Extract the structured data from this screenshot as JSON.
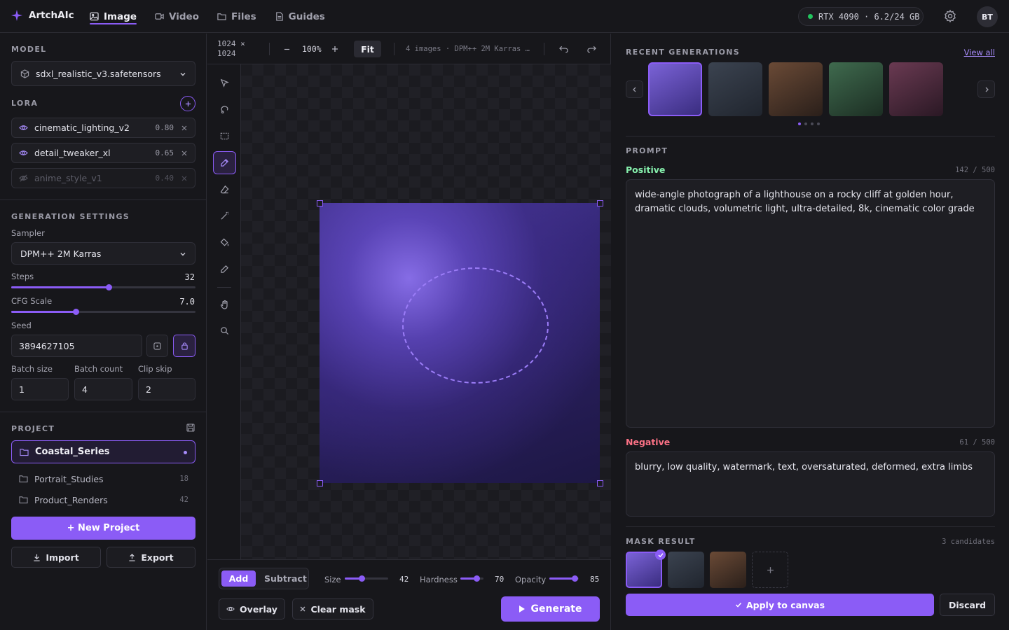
{
  "app": {
    "name": "ArtchAIc"
  },
  "nav": {
    "tabs": [
      {
        "label": "Image",
        "icon": "image-icon",
        "active": true
      },
      {
        "label": "Video",
        "icon": "video-icon"
      },
      {
        "label": "Files",
        "icon": "folder-icon"
      },
      {
        "label": "Guides",
        "icon": "document-icon"
      }
    ]
  },
  "status": {
    "gpu": "RTX 4090 · 6.2/24 GB",
    "gpu_color": "#22c55e"
  },
  "user": {
    "initials": "BT"
  },
  "model": {
    "title": "MODEL",
    "selected": "sdxl_realistic_v3.safetensors"
  },
  "lora": {
    "title": "LORA",
    "items": [
      {
        "name": "cinematic_lighting_v2",
        "weight": "0.80",
        "enabled": true
      },
      {
        "name": "detail_tweaker_xl",
        "weight": "0.65",
        "enabled": true
      },
      {
        "name": "anime_style_v1",
        "weight": "0.40",
        "enabled": false
      }
    ]
  },
  "generation": {
    "title": "GENERATION SETTINGS",
    "sampler_label": "Sampler",
    "sampler": "DPM++ 2M Karras",
    "steps_label": "Steps",
    "steps": "32",
    "steps_fraction": 0.53,
    "cfg_label": "CFG Scale",
    "cfg": "7.0",
    "cfg_fraction": 0.35,
    "seed_label": "Seed",
    "seed": "3894627105",
    "batch_size_label": "Batch size",
    "batch_size": "1",
    "batch_count_label": "Batch count",
    "batch_count": "4",
    "clip_skip_label": "Clip skip",
    "clip_skip": "2"
  },
  "project": {
    "title": "PROJECT",
    "active": "Coastal_Series",
    "items": [
      {
        "name": "Portrait_Studies",
        "count": "18"
      },
      {
        "name": "Product_Renders",
        "count": "42"
      }
    ],
    "new_label": "+ New Project",
    "import_label": "Import",
    "export_label": "Export"
  },
  "canvas": {
    "dim_w": "1024 ×",
    "dim_h": "1024",
    "zoom": "100%",
    "fit_label": "Fit",
    "info": "4 images · DPM++ 2M Karras …",
    "accent": "#8b5cf6"
  },
  "brush": {
    "mode_add": "Add",
    "mode_subtract": "Subtract",
    "size_label": "Size",
    "size": "42",
    "size_fraction": 0.38,
    "hardness_label": "Hardness",
    "hardness": "70",
    "hardness_fraction": 0.7,
    "opacity_label": "Opacity",
    "opacity": "85",
    "opacity_fraction": 0.85,
    "overlay_label": "Overlay",
    "clear_label": "Clear mask",
    "generate_label": "Generate"
  },
  "recent": {
    "title": "RECENT GENERATIONS",
    "view_all": "View all",
    "thumb_colors": [
      [
        "#7a62d6",
        "#3a2d80"
      ],
      [
        "#3b4350",
        "#20252e"
      ],
      [
        "#6a4a36",
        "#2a1f1a"
      ],
      [
        "#3f6a4e",
        "#1c2e23"
      ],
      [
        "#6a3a52",
        "#2a1824"
      ]
    ]
  },
  "prompt": {
    "title": "PROMPT",
    "positive_label": "Positive",
    "positive_count": "142 / 500",
    "positive": "wide-angle photograph of a lighthouse on a rocky cliff at golden hour, dramatic clouds, volumetric light, ultra-detailed, 8k, cinematic color grade",
    "negative_label": "Negative",
    "negative_count": "61 / 500",
    "negative": "blurry, low quality, watermark, text, oversaturated, deformed, extra limbs"
  },
  "mask_result": {
    "title": "MASK RESULT",
    "candidates": "3 candidates",
    "apply_label": "Apply to canvas",
    "discard_label": "Discard"
  }
}
